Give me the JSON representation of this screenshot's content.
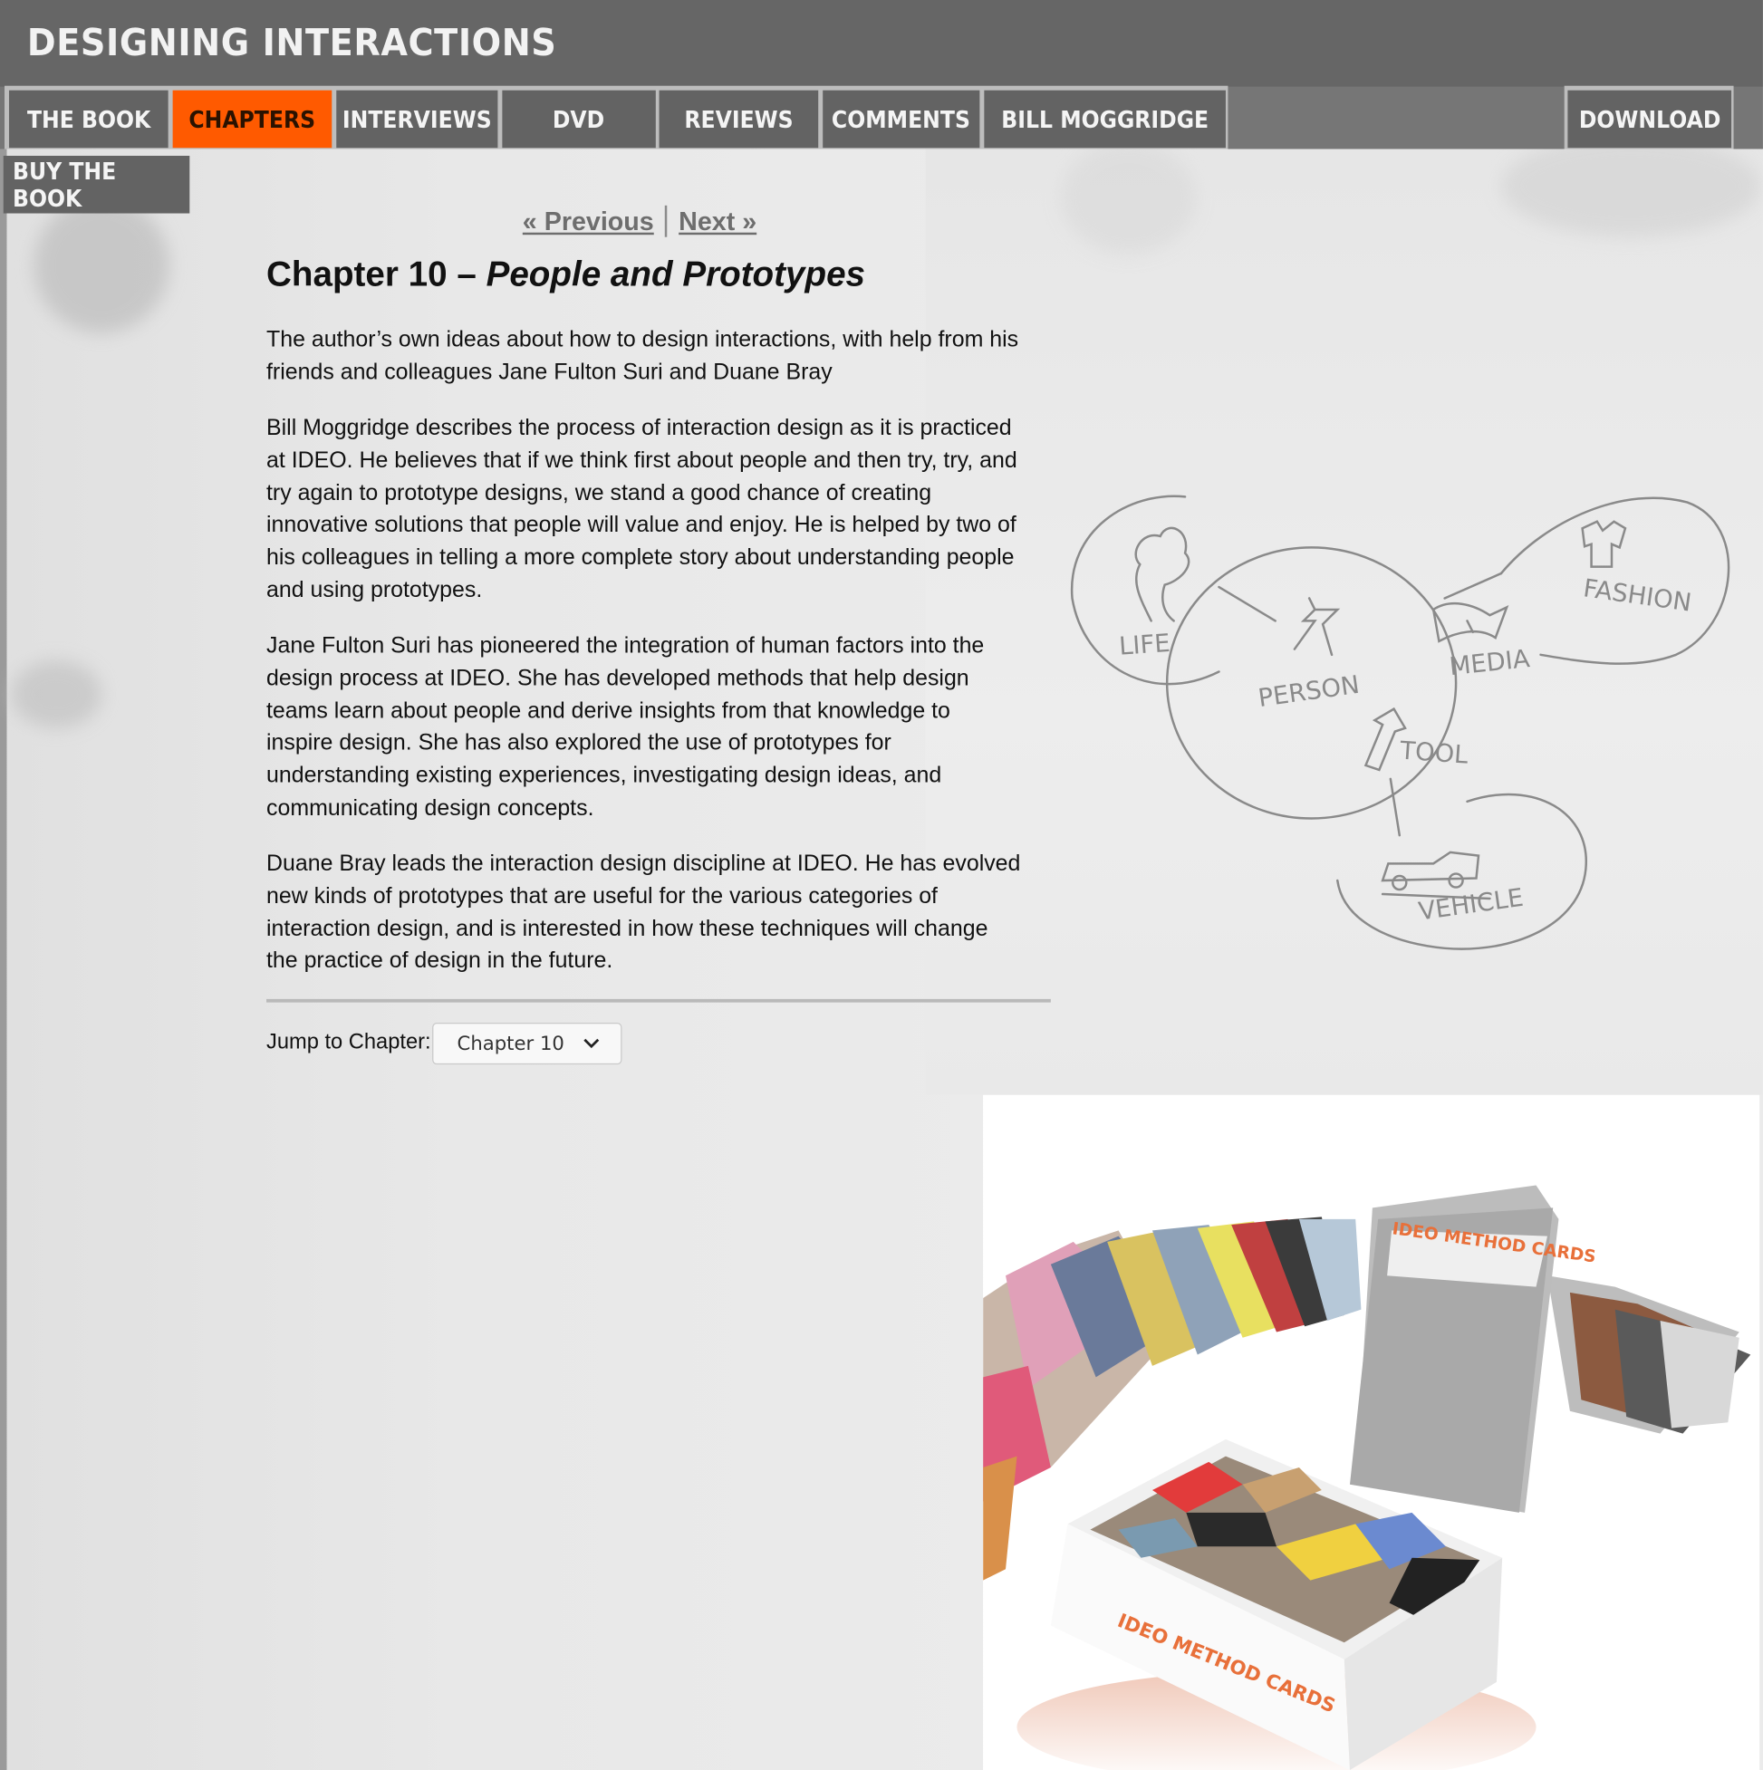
{
  "site": {
    "title": "DESIGNING INTERACTIONS"
  },
  "nav": {
    "tabs": [
      {
        "label": "THE BOOK"
      },
      {
        "label": "CHAPTERS"
      },
      {
        "label": "INTERVIEWS"
      },
      {
        "label": "DVD"
      },
      {
        "label": "REVIEWS"
      },
      {
        "label": "COMMENTS"
      },
      {
        "label": "BILL MOGGRIDGE"
      }
    ],
    "active": "CHAPTERS",
    "download": "DOWNLOAD",
    "buy": "BUY THE BOOK"
  },
  "pager": {
    "previous": "« Previous",
    "next": "Next »"
  },
  "chapter": {
    "title_prefix": "Chapter 10 –",
    "title_italic": "People and Prototypes",
    "paragraphs": [
      "The author’s own ideas about how to design interactions, with help from his friends and colleagues Jane Fulton Suri and Duane Bray",
      "Bill Moggridge describes the process of interaction design as it is practiced at IDEO. He believes that if we think first about people and then try, try, and try again to prototype designs, we stand a good chance of creating innovative solutions that people will value and enjoy. He is helped by two of his colleagues in telling a more complete story about understanding people and using prototypes.",
      "Jane Fulton Suri has pioneered the integration of human factors into the design process at IDEO. She has developed methods that help design teams learn about people and derive insights from that knowledge to inspire design. She has also explored the use of prototypes for understanding existing experiences, investigating design ideas, and communicating design concepts.",
      "Duane Bray leads the interaction design discipline at IDEO. He has evolved new kinds of prototypes that are useful for the various categories of interaction design, and is interested in how these techniques will change the practice of design in the future."
    ]
  },
  "jump": {
    "label": "Jump to Chapter:",
    "selected": "Chapter 10"
  },
  "sketch": {
    "labels": [
      "LIFE",
      "PERSON",
      "MEDIA",
      "FASHION",
      "TOOL",
      "VEHICLE"
    ]
  },
  "photo": {
    "card_text": "IDEO METHOD CARDS"
  },
  "colors": {
    "header": "#666666",
    "tab": "#636363",
    "active_tab": "#ff5a00"
  }
}
